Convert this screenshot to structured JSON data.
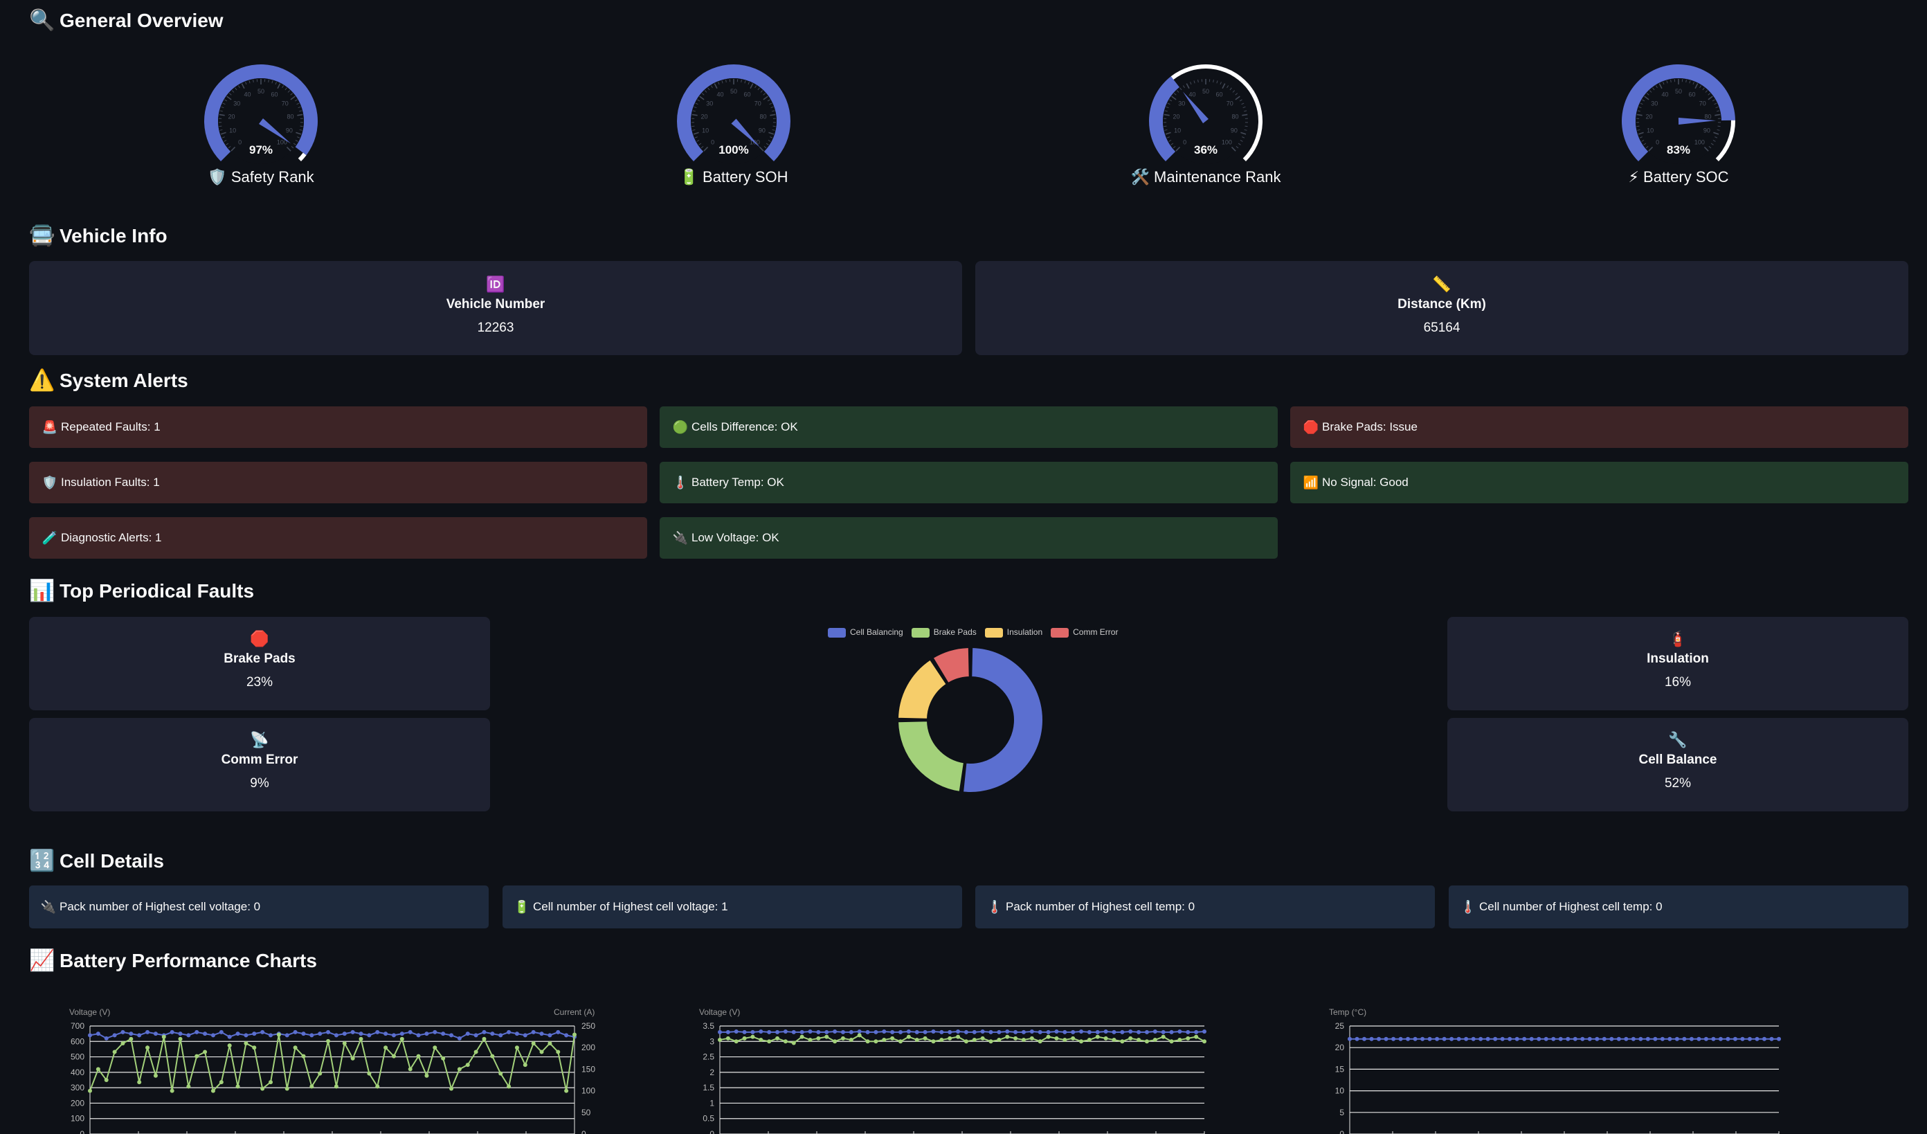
{
  "overview": {
    "title": "General Overview",
    "icon": "magnifier-icon",
    "gauges": [
      {
        "label": "Safety Rank",
        "emoji": "🛡️",
        "value": 97,
        "display": "97%",
        "ticks": [
          "0",
          "10",
          "20",
          "30",
          "40",
          "50",
          "60",
          "70",
          "80",
          "90",
          "100"
        ]
      },
      {
        "label": "Battery SOH",
        "emoji": "🔋",
        "value": 100,
        "display": "100%",
        "ticks": [
          "0",
          "10",
          "20",
          "30",
          "40",
          "50",
          "60",
          "70",
          "80",
          "90",
          "100"
        ]
      },
      {
        "label": "Maintenance Rank",
        "emoji": "🛠️",
        "value": 36,
        "display": "36%",
        "ticks": [
          "0",
          "10",
          "20",
          "30",
          "40",
          "50",
          "60",
          "70",
          "80",
          "90",
          "100"
        ]
      },
      {
        "label": "Battery SOC",
        "emoji": "⚡",
        "value": 83,
        "display": "83%",
        "ticks": [
          "0",
          "10",
          "20",
          "30",
          "40",
          "50",
          "60",
          "70",
          "80",
          "90",
          "100"
        ]
      }
    ]
  },
  "vehicle": {
    "title": "Vehicle Info",
    "icon": "bus-icon",
    "number": {
      "emoji": "🆔",
      "label": "Vehicle Number",
      "value": "12263"
    },
    "distance": {
      "emoji": "📏",
      "label": "Distance (Km)",
      "value": "65164"
    }
  },
  "alerts": {
    "title": "System Alerts",
    "icon": "warning-icon",
    "items": [
      {
        "emoji": "🚨",
        "text": "Repeated Faults: 1",
        "status": "red"
      },
      {
        "emoji": "🟢",
        "text": "Cells Difference: OK",
        "status": "green"
      },
      {
        "emoji": "🛑",
        "text": "Brake Pads: Issue",
        "status": "red"
      },
      {
        "emoji": "🛡️",
        "text": "Insulation Faults: 1",
        "status": "red"
      },
      {
        "emoji": "🌡️",
        "text": "Battery Temp: OK",
        "status": "green"
      },
      {
        "emoji": "📶",
        "text": "No Signal: Good",
        "status": "green"
      },
      {
        "emoji": "🧪",
        "text": "Diagnostic Alerts: 1",
        "status": "red"
      },
      {
        "emoji": "🔌",
        "text": "Low Voltage: OK",
        "status": "green"
      }
    ]
  },
  "faults": {
    "title": "Top Periodical Faults",
    "icon": "bar-chart-icon",
    "cards": [
      {
        "emoji": "🛑",
        "label": "Brake Pads",
        "value": "23%"
      },
      {
        "emoji": "📡",
        "label": "Comm Error",
        "value": "9%"
      },
      {
        "emoji": "🧯",
        "label": "Insulation",
        "value": "16%"
      },
      {
        "emoji": "🔧",
        "label": "Cell Balance",
        "value": "52%"
      }
    ]
  },
  "cells": {
    "title": "Cell Details",
    "icon": "numbers-icon",
    "items": [
      {
        "emoji": "🔌",
        "text": "Pack number of Highest cell voltage: 0"
      },
      {
        "emoji": "🔋",
        "text": "Cell number of Highest cell voltage: 1"
      },
      {
        "emoji": "🌡️",
        "text": "Pack number of Highest cell temp: 0"
      },
      {
        "emoji": "🌡️",
        "text": "Cell number of Highest cell temp: 0"
      }
    ]
  },
  "perf": {
    "title": "Battery Performance Charts",
    "icon": "line-chart-icon"
  },
  "colors": {
    "blue": "#5b6fd0",
    "green": "#a3d17a",
    "yellow": "#f6cd6a",
    "red": "#e06868",
    "white": "#ffffff"
  },
  "chart_data": [
    {
      "type": "pie",
      "donut": true,
      "categories": [
        "Cell Balancing",
        "Brake Pads",
        "Insulation",
        "Comm Error"
      ],
      "values": [
        52,
        23,
        16,
        9
      ],
      "legend": "top"
    },
    {
      "type": "line",
      "ylabel": "Voltage (V)",
      "y2label": "Current (A)",
      "ylim": [
        0,
        700
      ],
      "y2lim": [
        0,
        250
      ],
      "yticks": [
        "0",
        "100",
        "200",
        "300",
        "400",
        "500",
        "600",
        "700"
      ],
      "y2ticks": [
        "0",
        "50",
        "100",
        "150",
        "200",
        "250"
      ],
      "series": [
        {
          "axis": "left",
          "values": [
            640,
            650,
            620,
            640,
            660,
            650,
            640,
            660,
            650,
            640,
            660,
            650,
            640,
            660,
            650,
            640,
            660,
            630,
            650,
            640,
            650,
            660,
            640,
            650,
            640,
            660,
            650,
            640,
            650,
            660,
            640,
            650,
            660,
            650,
            640,
            660,
            650,
            640,
            650,
            660,
            640,
            650,
            660,
            650,
            640,
            620,
            650,
            640,
            660,
            650,
            640,
            660,
            650,
            640,
            660,
            650,
            640,
            660,
            640,
            630
          ]
        },
        {
          "axis": "right",
          "values": [
            100,
            150,
            125,
            190,
            210,
            220,
            120,
            200,
            135,
            225,
            100,
            220,
            110,
            180,
            190,
            100,
            120,
            205,
            110,
            210,
            200,
            105,
            120,
            230,
            105,
            200,
            180,
            110,
            140,
            215,
            110,
            210,
            175,
            220,
            140,
            110,
            200,
            180,
            220,
            150,
            180,
            135,
            200,
            175,
            105,
            150,
            160,
            190,
            220,
            180,
            140,
            110,
            200,
            160,
            210,
            190,
            210,
            190,
            100,
            230
          ]
        }
      ]
    },
    {
      "type": "line",
      "ylabel": "Voltage (V)",
      "ylim": [
        0,
        3.5
      ],
      "yticks": [
        "0",
        "0.5",
        "1",
        "1.5",
        "2",
        "2.5",
        "3",
        "3.5"
      ],
      "series": [
        {
          "values": [
            3.3,
            3.3,
            3.32,
            3.3,
            3.3,
            3.32,
            3.3,
            3.3,
            3.32,
            3.3,
            3.3,
            3.32,
            3.3,
            3.3,
            3.32,
            3.3,
            3.3,
            3.32,
            3.3,
            3.3,
            3.32,
            3.3,
            3.3,
            3.32,
            3.3,
            3.3,
            3.32,
            3.3,
            3.3,
            3.32,
            3.3,
            3.3,
            3.32,
            3.3,
            3.3,
            3.32,
            3.3,
            3.3,
            3.32,
            3.3,
            3.3,
            3.32,
            3.3,
            3.3,
            3.32,
            3.3,
            3.3,
            3.32,
            3.3,
            3.3,
            3.32,
            3.3,
            3.3,
            3.32,
            3.3,
            3.3,
            3.32,
            3.3,
            3.3,
            3.32
          ]
        },
        {
          "values": [
            3.05,
            3.1,
            3.0,
            3.1,
            3.15,
            3.05,
            3.0,
            3.1,
            3.0,
            2.95,
            3.15,
            3.05,
            3.1,
            3.15,
            3.0,
            3.1,
            3.05,
            3.2,
            3.0,
            3.0,
            3.05,
            3.1,
            3.0,
            3.15,
            3.05,
            3.1,
            3.0,
            3.05,
            3.1,
            3.15,
            3.0,
            3.05,
            3.1,
            3.0,
            3.05,
            3.15,
            3.1,
            3.05,
            3.1,
            3.0,
            3.15,
            3.1,
            3.05,
            3.1,
            3.0,
            3.05,
            3.15,
            3.1,
            3.05,
            3.0,
            3.1,
            3.05,
            3.0,
            3.05,
            3.15,
            3.0,
            3.05,
            3.1,
            3.15,
            3.0
          ]
        }
      ]
    },
    {
      "type": "line",
      "ylabel": "Temp (°C)",
      "ylim": [
        0,
        25
      ],
      "yticks": [
        "0",
        "5",
        "10",
        "15",
        "20",
        "25"
      ],
      "series": [
        {
          "values": [
            22,
            22,
            22,
            22,
            22,
            22,
            22,
            22,
            22,
            22,
            22,
            22,
            22,
            22,
            22,
            22,
            22,
            22,
            22,
            22,
            22,
            22,
            22,
            22,
            22,
            22,
            22,
            22,
            22,
            22,
            22,
            22,
            22,
            22,
            22,
            22,
            22,
            22,
            22,
            22,
            22,
            22,
            22,
            22,
            22,
            22,
            22,
            22,
            22,
            22,
            22,
            22,
            22,
            22,
            22,
            22,
            22,
            22,
            22,
            22
          ]
        }
      ]
    }
  ]
}
